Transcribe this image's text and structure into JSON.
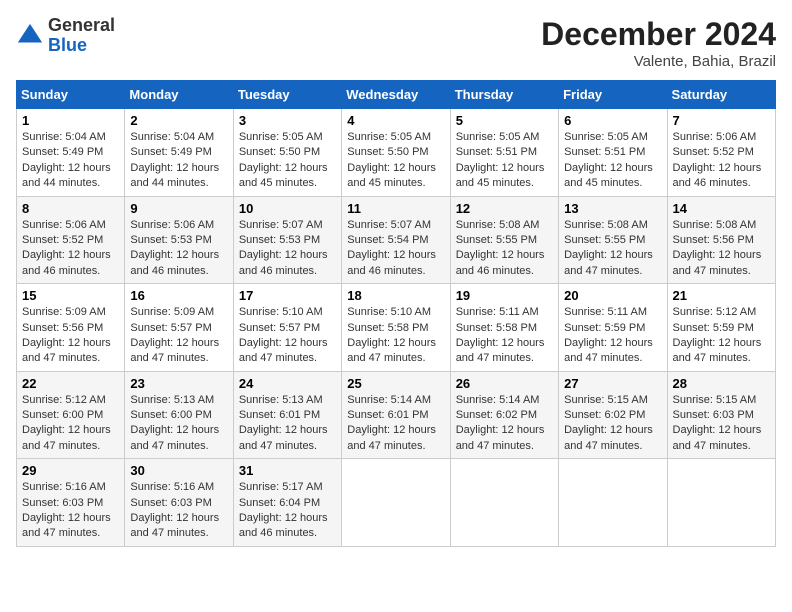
{
  "header": {
    "logo_general": "General",
    "logo_blue": "Blue",
    "month_title": "December 2024",
    "location": "Valente, Bahia, Brazil"
  },
  "days_of_week": [
    "Sunday",
    "Monday",
    "Tuesday",
    "Wednesday",
    "Thursday",
    "Friday",
    "Saturday"
  ],
  "weeks": [
    [
      {
        "day": 1,
        "sunrise": "5:04 AM",
        "sunset": "5:49 PM",
        "daylight": "12 hours and 44 minutes."
      },
      {
        "day": 2,
        "sunrise": "5:04 AM",
        "sunset": "5:49 PM",
        "daylight": "12 hours and 44 minutes."
      },
      {
        "day": 3,
        "sunrise": "5:05 AM",
        "sunset": "5:50 PM",
        "daylight": "12 hours and 45 minutes."
      },
      {
        "day": 4,
        "sunrise": "5:05 AM",
        "sunset": "5:50 PM",
        "daylight": "12 hours and 45 minutes."
      },
      {
        "day": 5,
        "sunrise": "5:05 AM",
        "sunset": "5:51 PM",
        "daylight": "12 hours and 45 minutes."
      },
      {
        "day": 6,
        "sunrise": "5:05 AM",
        "sunset": "5:51 PM",
        "daylight": "12 hours and 45 minutes."
      },
      {
        "day": 7,
        "sunrise": "5:06 AM",
        "sunset": "5:52 PM",
        "daylight": "12 hours and 46 minutes."
      }
    ],
    [
      {
        "day": 8,
        "sunrise": "5:06 AM",
        "sunset": "5:52 PM",
        "daylight": "12 hours and 46 minutes."
      },
      {
        "day": 9,
        "sunrise": "5:06 AM",
        "sunset": "5:53 PM",
        "daylight": "12 hours and 46 minutes."
      },
      {
        "day": 10,
        "sunrise": "5:07 AM",
        "sunset": "5:53 PM",
        "daylight": "12 hours and 46 minutes."
      },
      {
        "day": 11,
        "sunrise": "5:07 AM",
        "sunset": "5:54 PM",
        "daylight": "12 hours and 46 minutes."
      },
      {
        "day": 12,
        "sunrise": "5:08 AM",
        "sunset": "5:55 PM",
        "daylight": "12 hours and 46 minutes."
      },
      {
        "day": 13,
        "sunrise": "5:08 AM",
        "sunset": "5:55 PM",
        "daylight": "12 hours and 47 minutes."
      },
      {
        "day": 14,
        "sunrise": "5:08 AM",
        "sunset": "5:56 PM",
        "daylight": "12 hours and 47 minutes."
      }
    ],
    [
      {
        "day": 15,
        "sunrise": "5:09 AM",
        "sunset": "5:56 PM",
        "daylight": "12 hours and 47 minutes."
      },
      {
        "day": 16,
        "sunrise": "5:09 AM",
        "sunset": "5:57 PM",
        "daylight": "12 hours and 47 minutes."
      },
      {
        "day": 17,
        "sunrise": "5:10 AM",
        "sunset": "5:57 PM",
        "daylight": "12 hours and 47 minutes."
      },
      {
        "day": 18,
        "sunrise": "5:10 AM",
        "sunset": "5:58 PM",
        "daylight": "12 hours and 47 minutes."
      },
      {
        "day": 19,
        "sunrise": "5:11 AM",
        "sunset": "5:58 PM",
        "daylight": "12 hours and 47 minutes."
      },
      {
        "day": 20,
        "sunrise": "5:11 AM",
        "sunset": "5:59 PM",
        "daylight": "12 hours and 47 minutes."
      },
      {
        "day": 21,
        "sunrise": "5:12 AM",
        "sunset": "5:59 PM",
        "daylight": "12 hours and 47 minutes."
      }
    ],
    [
      {
        "day": 22,
        "sunrise": "5:12 AM",
        "sunset": "6:00 PM",
        "daylight": "12 hours and 47 minutes."
      },
      {
        "day": 23,
        "sunrise": "5:13 AM",
        "sunset": "6:00 PM",
        "daylight": "12 hours and 47 minutes."
      },
      {
        "day": 24,
        "sunrise": "5:13 AM",
        "sunset": "6:01 PM",
        "daylight": "12 hours and 47 minutes."
      },
      {
        "day": 25,
        "sunrise": "5:14 AM",
        "sunset": "6:01 PM",
        "daylight": "12 hours and 47 minutes."
      },
      {
        "day": 26,
        "sunrise": "5:14 AM",
        "sunset": "6:02 PM",
        "daylight": "12 hours and 47 minutes."
      },
      {
        "day": 27,
        "sunrise": "5:15 AM",
        "sunset": "6:02 PM",
        "daylight": "12 hours and 47 minutes."
      },
      {
        "day": 28,
        "sunrise": "5:15 AM",
        "sunset": "6:03 PM",
        "daylight": "12 hours and 47 minutes."
      }
    ],
    [
      {
        "day": 29,
        "sunrise": "5:16 AM",
        "sunset": "6:03 PM",
        "daylight": "12 hours and 47 minutes."
      },
      {
        "day": 30,
        "sunrise": "5:16 AM",
        "sunset": "6:03 PM",
        "daylight": "12 hours and 47 minutes."
      },
      {
        "day": 31,
        "sunrise": "5:17 AM",
        "sunset": "6:04 PM",
        "daylight": "12 hours and 46 minutes."
      },
      null,
      null,
      null,
      null
    ]
  ],
  "labels": {
    "sunrise": "Sunrise:",
    "sunset": "Sunset:",
    "daylight": "Daylight:"
  }
}
